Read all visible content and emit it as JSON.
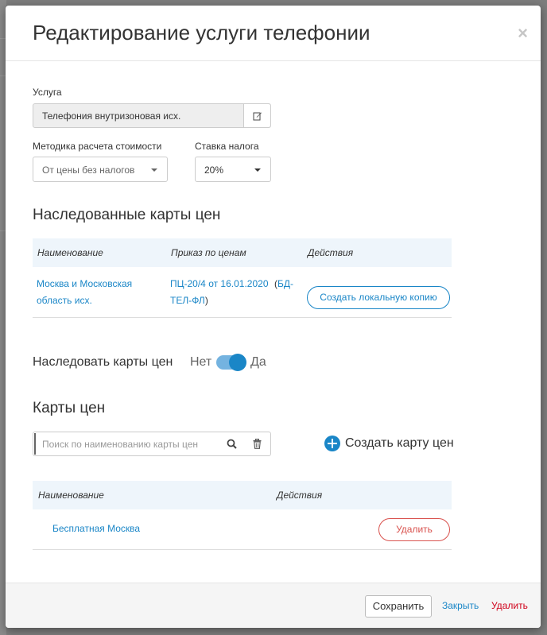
{
  "modal": {
    "title": "Редактирование услуги телефонии"
  },
  "service": {
    "label": "Услуга",
    "value": "Телефония внутризоновая исх."
  },
  "calc_method": {
    "label": "Методика расчета стоимости",
    "value": "От цены без налогов"
  },
  "tax_rate": {
    "label": "Ставка налога",
    "value": "20%"
  },
  "inherited": {
    "heading": "Наследованные карты цен",
    "columns": [
      "Наименование",
      "Приказ по ценам",
      "Действия"
    ],
    "row": {
      "name_line1": "Москва и Московская",
      "name_line2": "область исх.",
      "order_link": "ПЦ-20/4 от 16.01.2020",
      "order_code_open": "(",
      "order_code_line1": "БД-",
      "order_code_line2": "ТЕЛ-ФЛ",
      "order_code_close": ")",
      "action": "Создать локальную копию"
    }
  },
  "inherit_toggle": {
    "label": "Наследовать карты цен",
    "off_label": "Нет",
    "on_label": "Да",
    "value": true
  },
  "price_cards": {
    "heading": "Карты цен",
    "search_placeholder": "Поиск по наименованию карты цен",
    "create_label": "Создать карту цен",
    "columns": [
      "Наименование",
      "Действия"
    ],
    "rows": [
      {
        "name": "Бесплатная Москва",
        "action": "Удалить"
      }
    ]
  },
  "footer": {
    "save": "Сохранить",
    "close": "Закрыть",
    "delete": "Удалить"
  },
  "colors": {
    "accent": "#1a86c7",
    "danger": "#d9534f",
    "header_bg": "#eef5fb"
  }
}
